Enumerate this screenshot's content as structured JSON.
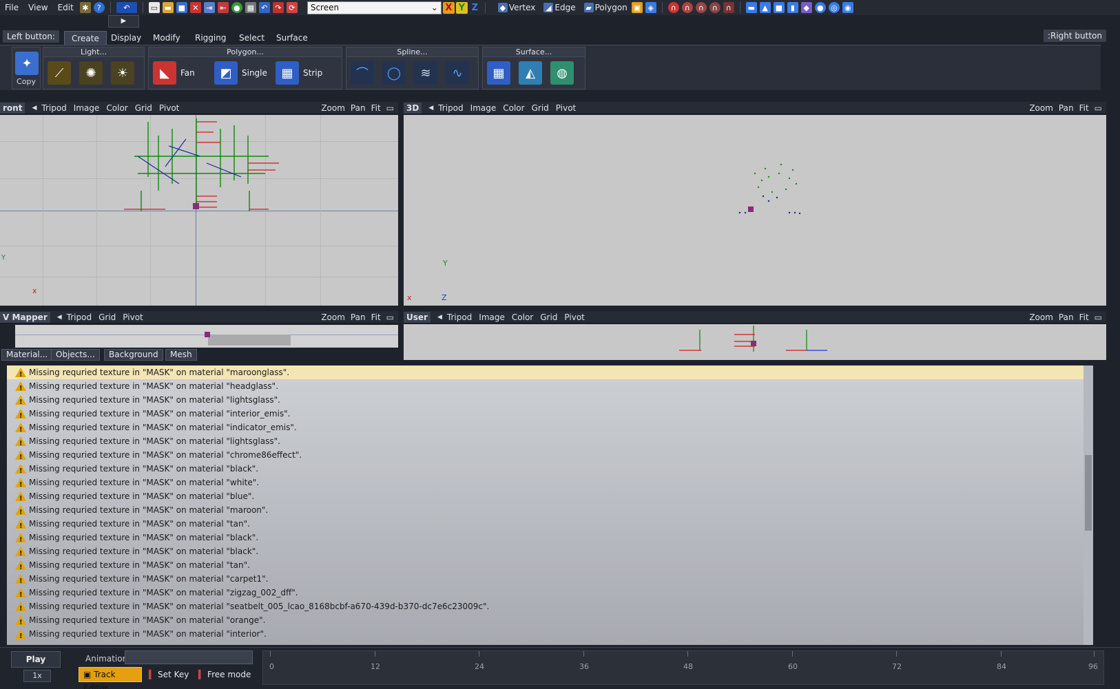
{
  "menubar": {
    "items": [
      "File",
      "View",
      "Edit"
    ],
    "screen_select": "Screen",
    "select_modes": [
      "Vertex",
      "Edge",
      "Polygon"
    ]
  },
  "ribbon": {
    "left_button": "Left button:",
    "right_button": ":Right button",
    "tabs": [
      "Create",
      "Display",
      "Modify",
      "Rigging",
      "Select",
      "Surface"
    ],
    "active_tab": "Create",
    "copy_label": "Copy",
    "groups": {
      "light": "Light...",
      "polygon": "Polygon...",
      "spline": "Spline...",
      "surface": "Surface..."
    },
    "polygon_buttons": [
      "Fan",
      "Single",
      "Strip"
    ]
  },
  "viewports": {
    "front": {
      "name": "ront",
      "options": [
        "Tripod",
        "Image",
        "Color",
        "Grid",
        "Pivot"
      ],
      "right": [
        "Zoom",
        "Pan",
        "Fit"
      ]
    },
    "threed": {
      "name": "3D",
      "options": [
        "Tripod",
        "Image",
        "Color",
        "Grid",
        "Pivot"
      ],
      "right": [
        "Zoom",
        "Pan",
        "Fit"
      ]
    },
    "uv": {
      "name": "V Mapper",
      "options": [
        "Tripod",
        "Grid",
        "Pivot"
      ],
      "right": [
        "Zoom",
        "Pan",
        "Fit"
      ]
    },
    "user": {
      "name": "User",
      "options": [
        "Tripod",
        "Image",
        "Color",
        "Grid",
        "Pivot"
      ],
      "right": [
        "Zoom",
        "Pan",
        "Fit"
      ]
    }
  },
  "panel_tabs": [
    "Material...",
    "Objects...",
    "Background",
    "Mesh"
  ],
  "log": [
    "Missing requried texture in \"MASK\" on material \"maroonglass\".",
    "Missing requried texture in \"MASK\" on material \"headglass\".",
    "Missing requried texture in \"MASK\" on material \"lightsglass\".",
    "Missing requried texture in \"MASK\" on material \"interior_emis\".",
    "Missing requried texture in \"MASK\" on material \"indicator_emis\".",
    "Missing requried texture in \"MASK\" on material \"lightsglass\".",
    "Missing requried texture in \"MASK\" on material \"chrome86effect\".",
    "Missing requried texture in \"MASK\" on material \"black\".",
    "Missing requried texture in \"MASK\" on material \"white\".",
    "Missing requried texture in \"MASK\" on material \"blue\".",
    "Missing requried texture in \"MASK\" on material \"maroon\".",
    "Missing requried texture in \"MASK\" on material \"tan\".",
    "Missing requried texture in \"MASK\" on material \"black\".",
    "Missing requried texture in \"MASK\" on material \"black\".",
    "Missing requried texture in \"MASK\" on material \"tan\".",
    "Missing requried texture in \"MASK\" on material \"carpet1\".",
    "Missing requried texture in \"MASK\" on material \"zigzag_002_dff\".",
    "Missing requried texture in \"MASK\" on material \"seatbelt_005_lcao_8168bcbf-a670-439d-b370-dc7e6c23009c\".",
    "Missing requried texture in \"MASK\" on material \"orange\".",
    "Missing requried texture in \"MASK\" on material \"interior\"."
  ],
  "bottom": {
    "play": "Play",
    "speed": "1x",
    "animation_label": "Animation:",
    "track_editor": "Track Editor",
    "set_key": "Set Key",
    "free_mode": "Free mode",
    "timeline_ticks": [
      "0",
      "12",
      "24",
      "36",
      "48",
      "60",
      "72",
      "84",
      "96"
    ]
  }
}
